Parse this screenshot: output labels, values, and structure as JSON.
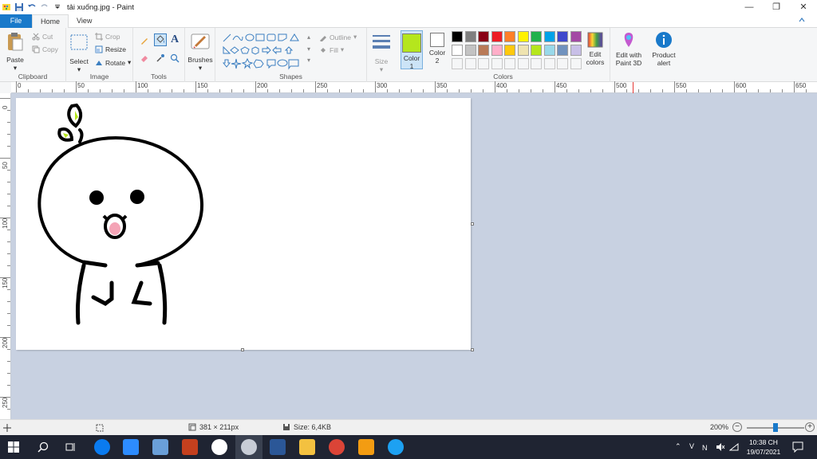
{
  "window": {
    "title": "tải xuống.jpg - Paint"
  },
  "tabs": {
    "file": "File",
    "home": "Home",
    "view": "View"
  },
  "clipboard": {
    "paste": "Paste",
    "cut": "Cut",
    "copy": "Copy",
    "label": "Clipboard"
  },
  "image": {
    "select": "Select",
    "crop": "Crop",
    "resize": "Resize",
    "rotate": "Rotate",
    "label": "Image"
  },
  "tools": {
    "label": "Tools"
  },
  "brushes": {
    "label": "Brushes"
  },
  "shapes": {
    "outline": "Outline",
    "fill": "Fill",
    "label": "Shapes"
  },
  "size": {
    "label": "Size"
  },
  "colors": {
    "color1_label": "Color\n1",
    "color2_label": "Color\n2",
    "edit_colors": "Edit colors",
    "label": "Colors",
    "color1": "#b5e61d",
    "color2": "#ffffff",
    "palette": [
      "#000000",
      "#7f7f7f",
      "#880015",
      "#ed1c24",
      "#ff7f27",
      "#fff200",
      "#22b14c",
      "#00a2e8",
      "#3f48cc",
      "#a349a4",
      "#ffffff",
      "#c3c3c3",
      "#b97a57",
      "#ffaec9",
      "#ffc90e",
      "#efe4b0",
      "#b5e61d",
      "#99d9ea",
      "#7092be",
      "#c8bfe7"
    ]
  },
  "paint3d": {
    "label": "Edit with Paint 3D"
  },
  "product_alert": {
    "label": "Product alert"
  },
  "ruler": {
    "h_labels": [
      "0",
      "50",
      "100",
      "150",
      "200",
      "250",
      "300",
      "350",
      "400",
      "450",
      "500",
      "550",
      "600",
      "650"
    ],
    "v_labels": [
      "0",
      "50",
      "100",
      "150",
      "200",
      "250"
    ]
  },
  "status": {
    "dimensions": "381 × 211px",
    "size": "Size: 6,4KB",
    "zoom": "200%"
  },
  "clock": {
    "time": "10:38 CH",
    "date": "19/07/2021"
  },
  "tray": {
    "lang": "V"
  }
}
